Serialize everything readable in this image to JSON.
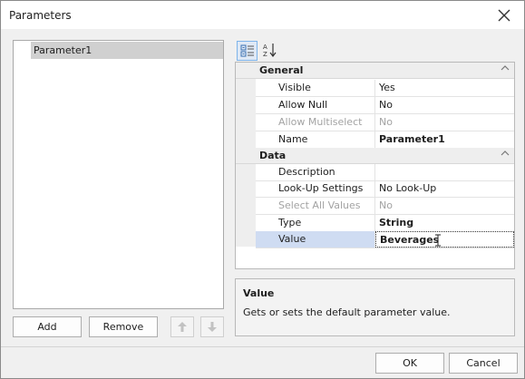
{
  "window": {
    "title": "Parameters"
  },
  "parameters_list": {
    "items": [
      {
        "label": "Parameter1"
      }
    ]
  },
  "list_buttons": {
    "add": "Add",
    "remove": "Remove"
  },
  "property_grid": {
    "categories": [
      {
        "label": "General",
        "rows": [
          {
            "name": "Visible",
            "value": "Yes"
          },
          {
            "name": "Allow Null",
            "value": "No"
          },
          {
            "name": "Allow Multiselect",
            "value": "No"
          },
          {
            "name": "Name",
            "value": "Parameter1"
          }
        ]
      },
      {
        "label": "Data",
        "rows": [
          {
            "name": "Description",
            "value": ""
          },
          {
            "name": "Look-Up Settings",
            "value": "No Look-Up"
          },
          {
            "name": "Select All Values",
            "value": "No"
          },
          {
            "name": "Type",
            "value": "String"
          },
          {
            "name": "Value",
            "value": "Beverages"
          }
        ]
      }
    ]
  },
  "description_panel": {
    "title": "Value",
    "text": "Gets or sets the default parameter value."
  },
  "footer": {
    "ok": "OK",
    "cancel": "Cancel"
  },
  "icons": {
    "categorized": "categorized-view-icon",
    "alphabetical": "sort-alphabetical-icon",
    "move_up": "arrow-up-icon",
    "move_down": "arrow-down-icon",
    "close": "close-icon",
    "collapse": "chevron-up-icon",
    "text_cursor": "i-beam-cursor-icon"
  },
  "colors": {
    "selection_row": "#cfdcf2",
    "list_selection": "#d0d0d0",
    "toolbar_active": "#dfe9f6"
  }
}
